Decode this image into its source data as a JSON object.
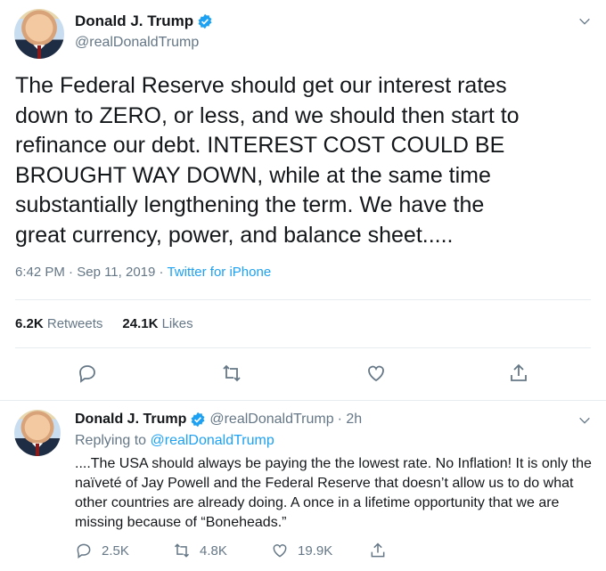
{
  "main": {
    "display_name": "Donald J. Trump",
    "handle": "@realDonaldTrump",
    "text": "The Federal Reserve should get our interest rates\ndown to ZERO, or less, and we should then start to\nrefinance our debt. INTEREST COST COULD BE\nBROUGHT WAY DOWN, while at the same time\nsubstantially lengthening the term. We have the\ngreat currency, power, and balance sheet.....",
    "time": "6:42 PM",
    "date": "Sep 11, 2019",
    "separator": "·",
    "source": "Twitter for iPhone",
    "retweets_count": "6.2K",
    "retweets_label": "Retweets",
    "likes_count": "24.1K",
    "likes_label": "Likes",
    "icons": [
      "verified-icon",
      "chevron-down-icon",
      "reply-icon",
      "retweet-icon",
      "like-icon",
      "share-icon"
    ]
  },
  "reply": {
    "display_name": "Donald J. Trump",
    "handle": "@realDonaldTrump",
    "time": "· 2h",
    "replying_prefix": "Replying to",
    "replying_to": "@realDonaldTrump",
    "text": "....The USA should always be paying the the lowest rate. No Inflation! It is only the naïveté of Jay Powell and the Federal Reserve that doesn’t allow us to do what other countries are already doing. A once in a lifetime opportunity that we are missing because of “Boneheads.”",
    "reply_count": "2.5K",
    "retweet_count": "4.8K",
    "like_count": "19.9K"
  },
  "colors": {
    "accent": "#1da1f2",
    "muted": "#657786",
    "text": "#14171a",
    "divider": "#e6ecf0"
  }
}
